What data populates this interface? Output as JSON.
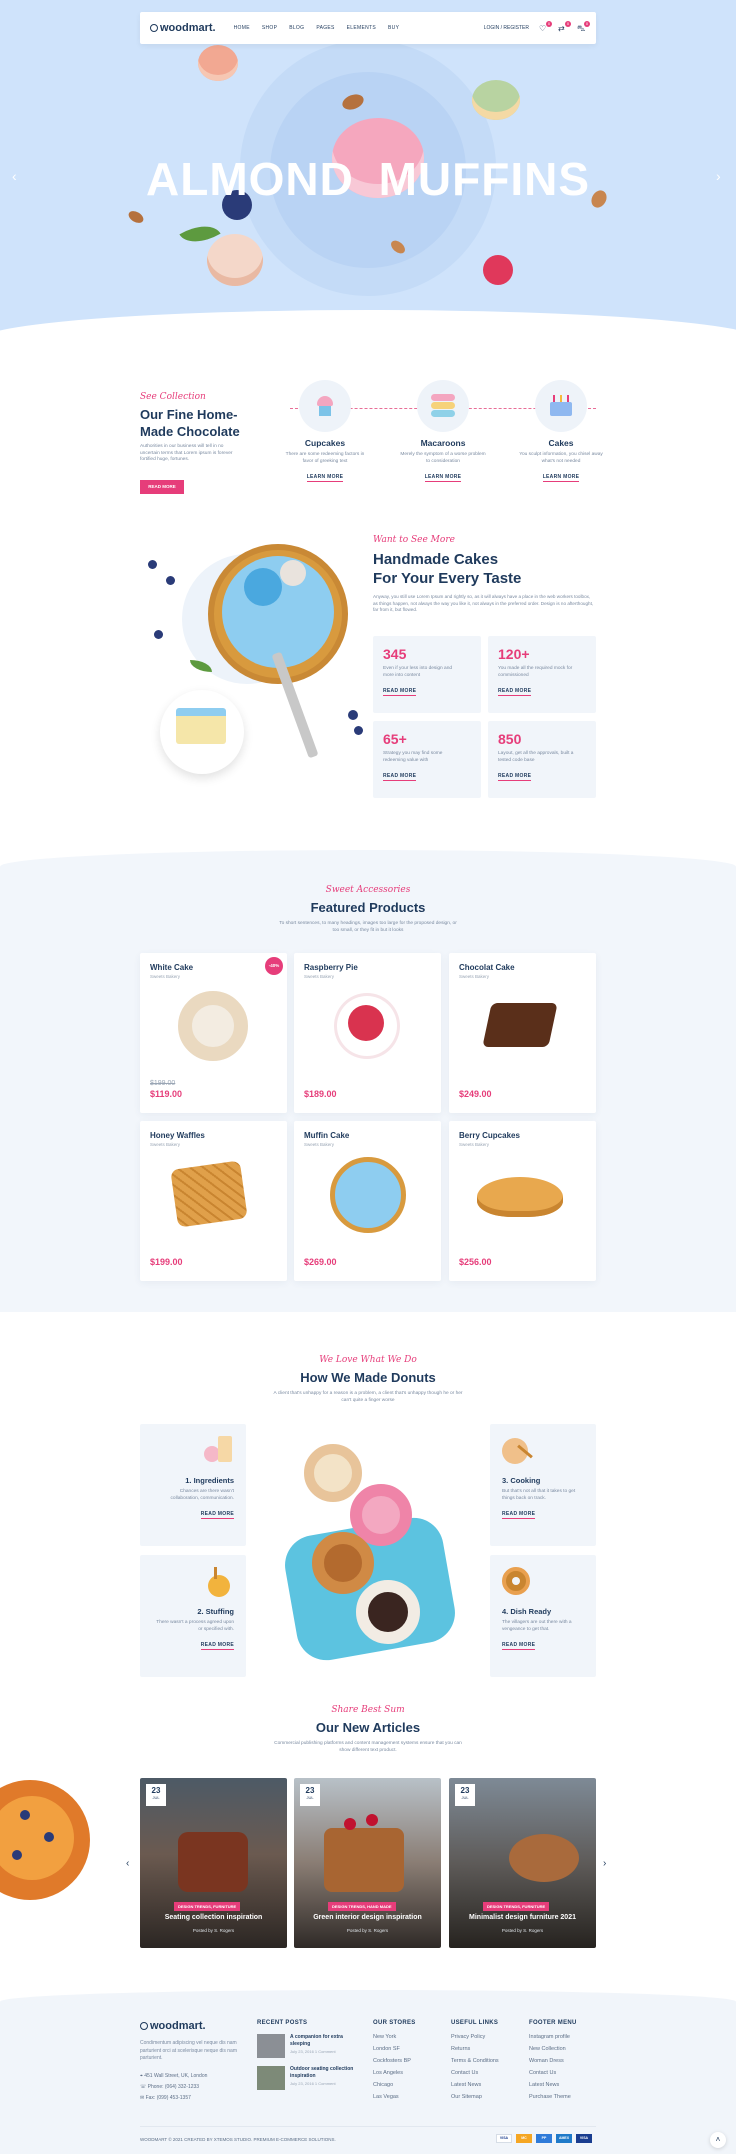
{
  "header": {
    "logo": "woodmart.",
    "nav": [
      "HOME",
      "SHOP",
      "BLOG",
      "PAGES",
      "ELEMENTS",
      "BUY"
    ],
    "login": "LOGIN / REGISTER",
    "wishlist_count": "0",
    "compare_count": "0",
    "cart_count": "0"
  },
  "hero": {
    "title_left": "ALMOND",
    "title_right": "MUFFINS"
  },
  "collection": {
    "kicker": "See Collection",
    "title_line1": "Our Fine Home-",
    "title_line2": "Made Chocolate",
    "text": "Authorities in our business will tell in no uncertain terms that Lorem ipsum is forever fortified huge, fortunes.",
    "button": "READ MORE",
    "items": [
      {
        "title": "Cupcakes",
        "text": "There are some redeeming factors in favor of greeking text",
        "link": "LEARN MORE"
      },
      {
        "title": "Macaroons",
        "text": "Merely the symptom of a worse problem to consideration",
        "link": "LEARN MORE"
      },
      {
        "title": "Cakes",
        "text": "You sculpt information, you chisel away what's not needed",
        "link": "LEARN MORE"
      }
    ]
  },
  "cakes": {
    "kicker": "Want to See More",
    "title_line1": "Handmade Cakes",
    "title_line2": "For Your Every Taste",
    "text": "Anyway, you still use Lorem Ipsum and rightly so, as it will always have a place in the web workers toolbox, as things happen, not always the way you like it, not always in the preferred order. Design is no afterthought, far from it, but flowed.",
    "stats": [
      {
        "value": "345",
        "text": "Even if your less into design and more into content",
        "link": "READ MORE"
      },
      {
        "value": "120+",
        "text": "You made all the required mock for commissioned",
        "link": "READ MORE"
      },
      {
        "value": "65+",
        "text": "Strategy you may find some redeeming value with",
        "link": "READ MORE"
      },
      {
        "value": "850",
        "text": "Layout, get all the approvals, built a tested code base",
        "link": "READ MORE"
      }
    ]
  },
  "featured": {
    "kicker": "Sweet Accessories",
    "title": "Featured Products",
    "text": "To short sentences, to many headings, images too large for the proposed design, or too small, or they fit in but it looks",
    "products": [
      {
        "name": "White Cake",
        "cat": "Sweets Bakery",
        "old_price": "$199.00",
        "price": "$119.00",
        "badge": "-40%"
      },
      {
        "name": "Raspberry Pie",
        "cat": "Sweets Bakery",
        "old_price": "",
        "price": "$189.00",
        "badge": ""
      },
      {
        "name": "Chocolat Cake",
        "cat": "Sweets Bakery",
        "old_price": "",
        "price": "$249.00",
        "badge": ""
      },
      {
        "name": "Honey Waffles",
        "cat": "Sweets Bakery",
        "old_price": "",
        "price": "$199.00",
        "badge": ""
      },
      {
        "name": "Muffin Cake",
        "cat": "Sweets Bakery",
        "old_price": "",
        "price": "$269.00",
        "badge": ""
      },
      {
        "name": "Berry Cupcakes",
        "cat": "Sweets Bakery",
        "old_price": "",
        "price": "$256.00",
        "badge": ""
      }
    ]
  },
  "donuts": {
    "kicker": "We Love What We Do",
    "title": "How We Made Donuts",
    "text": "A client that's unhappy for a reason is a problem, a client that's unhappy though he or her can't quite a finger worse",
    "steps": [
      {
        "title": "1. Ingredients",
        "text": "Chances are there wasn't collaboration, communication.",
        "link": "READ MORE"
      },
      {
        "title": "2. Stuffing",
        "text": "There wasn't a process agreed upon or specified with.",
        "link": "READ MORE"
      },
      {
        "title": "3. Cooking",
        "text": "But that's not all that it takes to get things back on track.",
        "link": "READ MORE"
      },
      {
        "title": "4. Dish Ready",
        "text": "The villagers are out there with a vengeance to get that.",
        "link": "READ MORE"
      }
    ]
  },
  "articles": {
    "kicker": "Share Best Sum",
    "title": "Our New Articles",
    "text": "Commercial publishing platforms and content management systems ensure that you can show different text product.",
    "items": [
      {
        "day": "23",
        "month": "JUL",
        "tags": "DESIGN TRENDS, FURNITURE",
        "title": "Seating collection inspiration",
        "meta": "Posted by  S. Rogers"
      },
      {
        "day": "23",
        "month": "JUL",
        "tags": "DESIGN TRENDS, HAND MADE",
        "title": "Green interior design inspiration",
        "meta": "Posted by  S. Rogers"
      },
      {
        "day": "23",
        "month": "JUL",
        "tags": "DESIGN TRENDS, FURNITURE",
        "title": "Minimalist design furniture 2021",
        "meta": "Posted by  S. Rogers"
      }
    ]
  },
  "footer": {
    "logo": "woodmart.",
    "about": "Condimentum adipiscing vel neque dis nam parturient orci at scelerisque neque dis nam parturient.",
    "address": "451 Wall Street, UK, London",
    "phone": "Phone: (064) 332-1233",
    "fax": "Fax: (099) 453-1357",
    "recent_title": "RECENT POSTS",
    "recent": [
      {
        "title": "A companion for extra sleeping",
        "date": "July 23, 2016   1 Comment"
      },
      {
        "title": "Outdoor seating collection inspiration",
        "date": "July 23, 2016   1 Comment"
      }
    ],
    "stores_title": "OUR STORES",
    "stores": [
      "New York",
      "London SF",
      "Cockfosters BP",
      "Los Angeles",
      "Chicago",
      "Las Vegas"
    ],
    "links_title": "USEFUL LINKS",
    "links": [
      "Privacy Policy",
      "Returns",
      "Terms & Conditions",
      "Contact Us",
      "Latest News",
      "Our Sitemap"
    ],
    "menu_title": "FOOTER MENU",
    "menu": [
      "Instagram profile",
      "New Collection",
      "Woman Dress",
      "Contact Us",
      "Latest News",
      "Purchase Theme"
    ],
    "copyright": "WOODMART © 2021 CREATED BY XTEMOS STUDIO. PREMIUM E-COMMERCE SOLUTIONS.",
    "payments": [
      "VISA",
      "MC",
      "PP",
      "AMEX",
      "VISA"
    ]
  },
  "colors": {
    "accent": "#e63d7a",
    "navy": "#1f3a5c",
    "hero_bg": "#cfe3fb",
    "card_bg": "#f1f5fa"
  }
}
